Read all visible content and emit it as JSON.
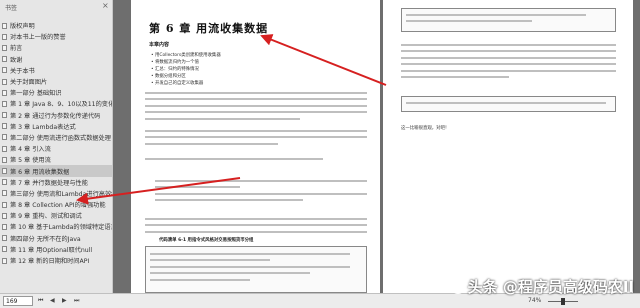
{
  "sidebar": {
    "title": "书签",
    "close": "×",
    "items": [
      {
        "label": "版权声明"
      },
      {
        "label": "对本书上一版的赞誉"
      },
      {
        "label": "前言"
      },
      {
        "label": "致谢"
      },
      {
        "label": "关于本书"
      },
      {
        "label": "关于封面图片"
      },
      {
        "label": "第一部分 基础知识"
      },
      {
        "label": "第 1 章 Java 8、9、10以及11的变化"
      },
      {
        "label": "第 2 章 通过行为参数化传递代码"
      },
      {
        "label": "第 3 章 Lambda表达式"
      },
      {
        "label": "第二部分 使用流进行函数式数据处理"
      },
      {
        "label": "第 4 章 引入流"
      },
      {
        "label": "第 5 章 使用流"
      },
      {
        "label": "第 6 章 用流收集数据",
        "active": true
      },
      {
        "label": "第 7 章 并行数据处理与性能"
      },
      {
        "label": "第三部分 使用流和Lambda进行高效编程"
      },
      {
        "label": "第 8 章 Collection API的增强功能"
      },
      {
        "label": "第 9 章 重构、测试和调试"
      },
      {
        "label": "第 10 章 基于Lambda的领域特定语言"
      },
      {
        "label": "第四部分 无所不在的Java"
      },
      {
        "label": "第 11 章 用Optional取代null"
      },
      {
        "label": "第 12 章 新的日期和时间API"
      }
    ]
  },
  "left_page": {
    "chapter_title": "第 6 章  用流收集数据",
    "section_heading": "本章内容",
    "bullets": [
      "用Collectors类创建和使用收集器",
      "将数据流归约为一个值",
      "汇总：归约的特殊情况",
      "数据分组和分区",
      "开发自己的自定义收集器"
    ],
    "code_caption": "代码清单 6-1  用指令式风格对交易按照货币分组"
  },
  "right_page": {
    "closing_text": "这一比喻很直观，对吧！"
  },
  "statusbar": {
    "page_number": "169",
    "zoom": "74%",
    "nav_first": "⏮",
    "nav_prev": "◀",
    "nav_next": "▶",
    "nav_last": "⏭"
  },
  "watermark": "头条 @程序员高级码农II"
}
